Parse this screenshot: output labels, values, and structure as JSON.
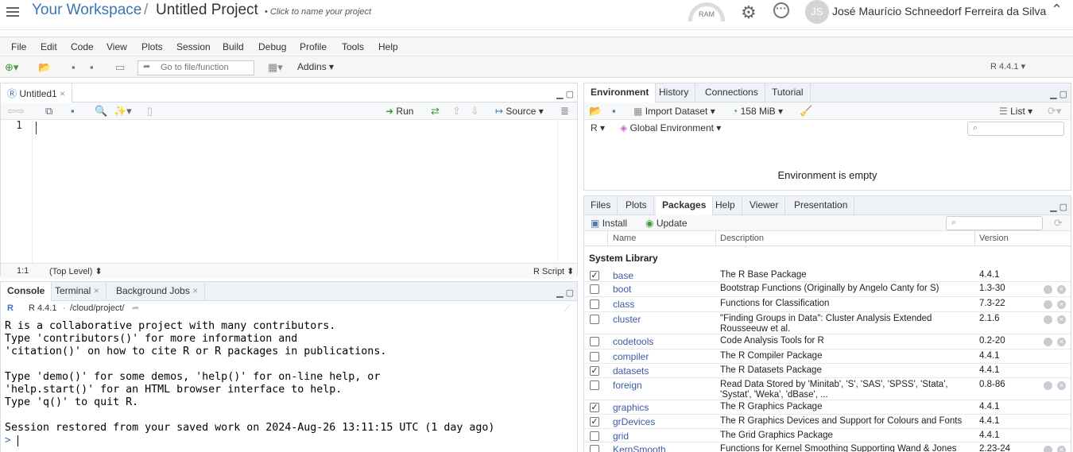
{
  "header": {
    "workspace": "Your Workspace",
    "separator": "/",
    "project": "Untitled Project",
    "click_to_name": "Click to name your project",
    "ram_label": "RAM",
    "avatar_initials": "JS",
    "user_name": "José Maurício Schneedorf Ferreira da Silva"
  },
  "menu": [
    "File",
    "Edit",
    "Code",
    "View",
    "Plots",
    "Session",
    "Build",
    "Debug",
    "Profile",
    "Tools",
    "Help"
  ],
  "toolbar": {
    "goto_placeholder": "Go to file/function",
    "addins": "Addins",
    "r_version": "R 4.4.1"
  },
  "editor": {
    "tab": "Untitled1",
    "run": "Run",
    "source": "Source",
    "line_number": "1",
    "position": "1:1",
    "scope": "(Top Level)",
    "filetype": "R Script"
  },
  "console": {
    "tabs": [
      "Console",
      "Terminal",
      "Background Jobs"
    ],
    "r_version": "R 4.4.1",
    "path": "/cloud/project/",
    "lines": [
      "R is a collaborative project with many contributors.",
      "Type 'contributors()' for more information and",
      "'citation()' on how to cite R or R packages in publications.",
      "",
      "Type 'demo()' for some demos, 'help()' for on-line help, or",
      "'help.start()' for an HTML browser interface to help.",
      "Type 'q()' to quit R.",
      "",
      "Session restored from your saved work on 2024-Aug-26 13:11:15 UTC (1 day ago)"
    ],
    "prompt": ">"
  },
  "environment": {
    "tabs": [
      "Environment",
      "History",
      "Connections",
      "Tutorial"
    ],
    "import_dataset": "Import Dataset",
    "memory": "158 MiB",
    "list_view": "List",
    "language": "R",
    "scope": "Global Environment",
    "empty_message": "Environment is empty"
  },
  "files": {
    "tabs": [
      "Files",
      "Plots",
      "Packages",
      "Help",
      "Viewer",
      "Presentation"
    ],
    "install": "Install",
    "update": "Update",
    "columns": [
      "Name",
      "Description",
      "Version"
    ],
    "section": "System Library",
    "packages": [
      {
        "checked": true,
        "name": "base",
        "desc": "The R Base Package",
        "version": "4.4.1",
        "removable": false
      },
      {
        "checked": false,
        "name": "boot",
        "desc": "Bootstrap Functions (Originally by Angelo Canty for S)",
        "version": "1.3-30",
        "removable": true
      },
      {
        "checked": false,
        "name": "class",
        "desc": "Functions for Classification",
        "version": "7.3-22",
        "removable": true
      },
      {
        "checked": false,
        "name": "cluster",
        "desc": "\"Finding Groups in Data\": Cluster Analysis Extended Rousseeuw et al.",
        "version": "2.1.6",
        "removable": true
      },
      {
        "checked": false,
        "name": "codetools",
        "desc": "Code Analysis Tools for R",
        "version": "0.2-20",
        "removable": true
      },
      {
        "checked": false,
        "name": "compiler",
        "desc": "The R Compiler Package",
        "version": "4.4.1",
        "removable": false
      },
      {
        "checked": true,
        "name": "datasets",
        "desc": "The R Datasets Package",
        "version": "4.4.1",
        "removable": false
      },
      {
        "checked": false,
        "name": "foreign",
        "desc": "Read Data Stored by 'Minitab', 'S', 'SAS', 'SPSS', 'Stata', 'Systat', 'Weka', 'dBase', ...",
        "version": "0.8-86",
        "removable": true
      },
      {
        "checked": true,
        "name": "graphics",
        "desc": "The R Graphics Package",
        "version": "4.4.1",
        "removable": false
      },
      {
        "checked": true,
        "name": "grDevices",
        "desc": "The R Graphics Devices and Support for Colours and Fonts",
        "version": "4.4.1",
        "removable": false
      },
      {
        "checked": false,
        "name": "grid",
        "desc": "The Grid Graphics Package",
        "version": "4.4.1",
        "removable": false
      },
      {
        "checked": false,
        "name": "KernSmooth",
        "desc": "Functions for Kernel Smoothing Supporting Wand & Jones",
        "version": "2.23-24",
        "removable": true
      }
    ]
  }
}
